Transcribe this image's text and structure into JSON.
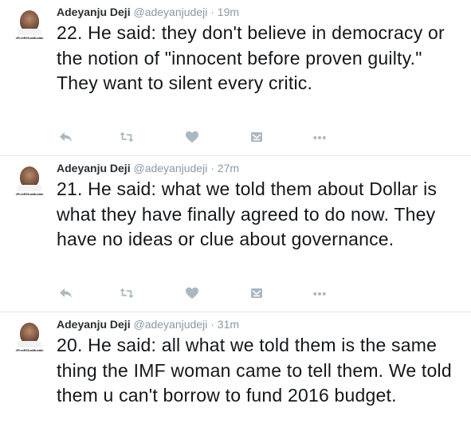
{
  "tweets": [
    {
      "name": "Adeyanju Deji",
      "handle": "@adeyanjudeji",
      "separator": "·",
      "time": "19m",
      "text": "22. He said: they don't believe in democracy or the notion of \"innocent before proven guilty.\" They want to silent every critic.",
      "avatar_tag": "#FreeElGusMustah"
    },
    {
      "name": "Adeyanju Deji",
      "handle": "@adeyanjudeji",
      "separator": "·",
      "time": "27m",
      "text": "21. He said: what we told them about Dollar is what they have finally agreed to do now. They have no ideas or clue about governance.",
      "avatar_tag": "#FreeElGusMustah"
    },
    {
      "name": "Adeyanju Deji",
      "handle": "@adeyanjudeji",
      "separator": "·",
      "time": "31m",
      "text": "20. He said: all what we told them is the same thing the IMF woman came to tell them. We told them u can't borrow to fund 2016 budget.",
      "avatar_tag": "#FreeElGusMustah"
    }
  ],
  "icons": {
    "reply": "reply-icon",
    "retweet": "retweet-icon",
    "like": "heart-icon",
    "dm": "direct-message-icon",
    "more": "more-dots-icon"
  },
  "colors": {
    "icon": "#aab8c2",
    "meta": "#8899a6",
    "text": "#14171a",
    "divider": "#e1e8ed"
  }
}
